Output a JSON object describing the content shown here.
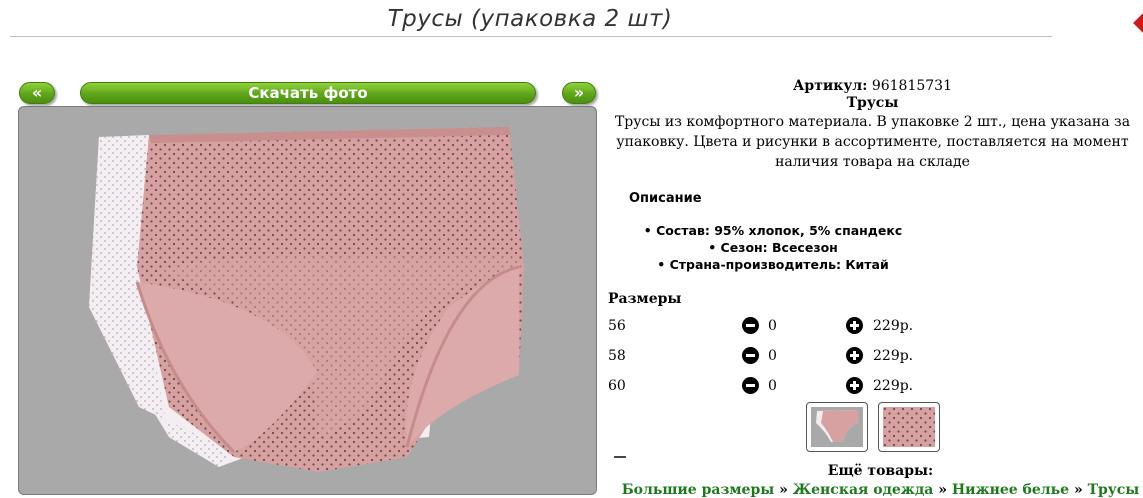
{
  "page": {
    "title": "Трусы (упаковка 2 шт)"
  },
  "gallery": {
    "prev_label": "«",
    "next_label": "»",
    "download_label": "Скачать фото"
  },
  "product": {
    "sku_label": "Артикул:",
    "sku_value": "961815731",
    "name": "Трусы",
    "description": "Трусы из комфортного материала. В упаковке 2 шт., цена указана за упаковку. Цвета и рисунки в ассортименте, поставляется на момент наличия товара на складе"
  },
  "details": {
    "heading": "Описание",
    "attributes": [
      "Состав: 95% хлопок, 5% спандекс",
      "Сезон: Всесезон",
      "Страна-производитель: Китай"
    ]
  },
  "sizes": {
    "heading": "Размеры",
    "rows": [
      {
        "size": "56",
        "qty": "0",
        "price": "229р."
      },
      {
        "size": "58",
        "qty": "0",
        "price": "229р."
      },
      {
        "size": "60",
        "qty": "0",
        "price": "229р."
      }
    ]
  },
  "more": {
    "heading": "Ещё товары:",
    "breadcrumb": [
      "Большие размеры",
      "Женская одежда",
      "Нижнее белье",
      "Трусы"
    ],
    "separator": "»"
  },
  "colors": {
    "button_green": "#5fa51a",
    "photo_background": "#a9a9a9",
    "garment_pink": "#d9a3a3",
    "link_green": "#1c7a1c"
  }
}
